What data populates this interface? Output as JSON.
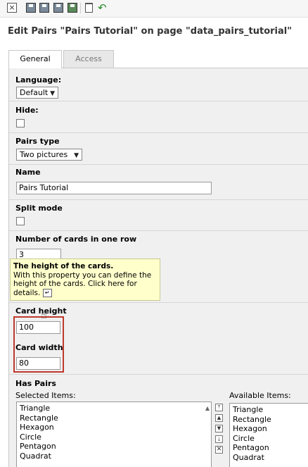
{
  "toolbar": {
    "close_icon": "×",
    "undo_icon": "↶"
  },
  "page_title": "Edit Pairs \"Pairs Tutorial\" on page \"data_pairs_tutorial\"",
  "tabs": [
    {
      "label": "General",
      "active": true
    },
    {
      "label": "Access",
      "active": false
    }
  ],
  "fields": {
    "language": {
      "label": "Language:",
      "value": "Default"
    },
    "hide": {
      "label": "Hide:",
      "checked": false
    },
    "pairs_type": {
      "label": "Pairs type",
      "value": "Two pictures"
    },
    "name": {
      "label": "Name",
      "value": "Pairs Tutorial"
    },
    "split_mode": {
      "label": "Split mode",
      "checked": false
    },
    "cards_per_row": {
      "label": "Number of cards in one row",
      "value": "3"
    },
    "card_height": {
      "label": "Card height",
      "value": "100"
    },
    "card_width": {
      "label": "Card width",
      "value": "80"
    },
    "has_pairs": {
      "label": "Has Pairs"
    }
  },
  "tooltip": {
    "title": "The height of the cards.",
    "line1": "With this property you can define the",
    "line2": "height of the cards. Click here for",
    "line3": "details."
  },
  "selected_items": {
    "label": "Selected Items:",
    "items": [
      "Triangle",
      "Rectangle",
      "Hexagon",
      "Circle",
      "Pentagon",
      "Quadrat"
    ]
  },
  "available_items": {
    "label": "Available Items:",
    "items": [
      "Triangle",
      "Rectangle",
      "Hexagon",
      "Circle",
      "Pentagon",
      "Quadrat"
    ]
  },
  "highlight_color": "#c0392b"
}
